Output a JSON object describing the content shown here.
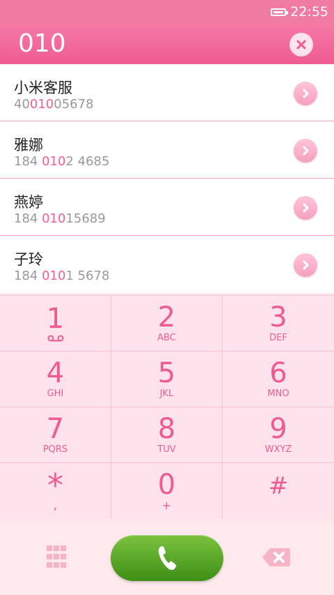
{
  "status_bar": {
    "time": "22:55",
    "battery_icon": "battery-icon"
  },
  "input": {
    "number": "010"
  },
  "contacts": [
    {
      "name": "小米客服",
      "number_pre": "40",
      "number_hl": "010",
      "number_post": "05678"
    },
    {
      "name": "雅娜",
      "number_pre": "184 ",
      "number_hl": "010",
      "number_post": "2 4685"
    },
    {
      "name": "燕婷",
      "number_pre": "184 ",
      "number_hl": "010",
      "number_post": "15689"
    },
    {
      "name": "子玲",
      "number_pre": "184 ",
      "number_hl": "010",
      "number_post": "1 5678"
    }
  ],
  "keypad": [
    {
      "digit": "1",
      "letters": ""
    },
    {
      "digit": "2",
      "letters": "ABC"
    },
    {
      "digit": "3",
      "letters": "DEF"
    },
    {
      "digit": "4",
      "letters": "GHI"
    },
    {
      "digit": "5",
      "letters": "JKL"
    },
    {
      "digit": "6",
      "letters": "MNO"
    },
    {
      "digit": "7",
      "letters": "PQRS"
    },
    {
      "digit": "8",
      "letters": "TUV"
    },
    {
      "digit": "9",
      "letters": "WXYZ"
    },
    {
      "digit": "*",
      "letters": ","
    },
    {
      "digit": "0",
      "letters": "+"
    },
    {
      "digit": "#",
      "letters": ""
    }
  ],
  "colors": {
    "accent": "#f05a90",
    "call_green": "#4a9e1d"
  }
}
